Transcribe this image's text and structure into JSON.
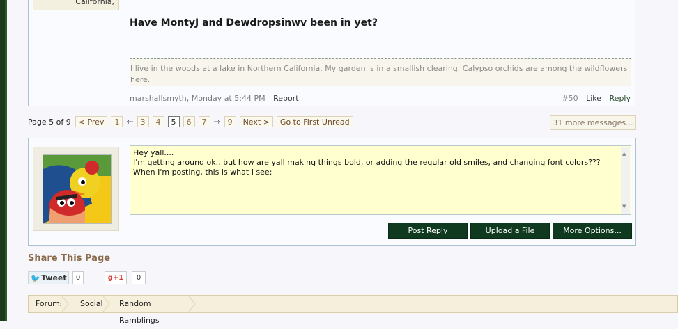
{
  "post": {
    "location": "California,",
    "title": "Have MontyJ and Dewdropsinwv been in yet?",
    "signature": "I live in the woods at a lake in Northern California. My garden is in a smallish clearing. Calypso orchids are among the wildflowers here.",
    "meta": "marshallsmyth, Monday at 5:44 PM",
    "report": "Report",
    "number": "#50",
    "like": "Like",
    "reply": "Reply"
  },
  "pagenav": {
    "label": "Page 5 of 9",
    "prev": "< Prev",
    "pages_before": [
      "1",
      "←",
      "3",
      "4"
    ],
    "current": "5",
    "pages_after": [
      "6",
      "7",
      "→",
      "9"
    ],
    "next": "Next >",
    "first_unread": "Go to First Unread",
    "more_messages": "31 more messages..."
  },
  "reply_box": {
    "text_line1": "Hey yall....",
    "text_line2": "I'm getting around ok.. but how are yall making things bold, or adding the regular old smiles, and changing font colors???",
    "text_line3": "When I'm posting, this is what I see:",
    "post_reply": "Post Reply",
    "upload": "Upload a File",
    "more_options": "More Options..."
  },
  "share": {
    "title": "Share This Page",
    "tweet": "Tweet",
    "tweet_count": "0",
    "gplus": "+1",
    "gplus_count": "0"
  },
  "breadcrumb": [
    "Forums",
    "Social",
    "Random Ramblings"
  ],
  "colors": {
    "accent_green": "#0f3a1f",
    "brown_text": "#8a6a4a",
    "textarea_bg": "#ffffd0"
  }
}
